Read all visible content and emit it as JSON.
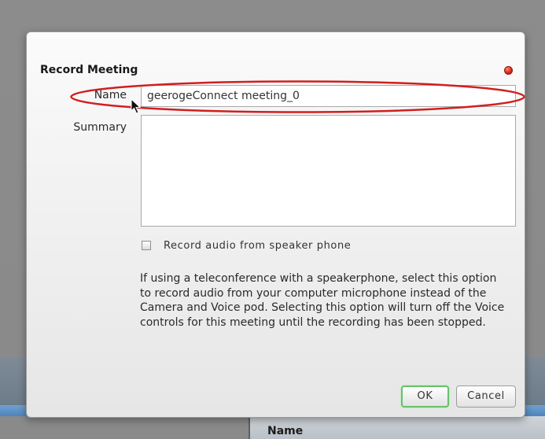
{
  "background": {
    "panel_header": "Name"
  },
  "dialog": {
    "title": "Record Meeting",
    "name_label": "Name",
    "name_value": "geerogeConnect meeting_0",
    "summary_label": "Summary",
    "summary_value": "",
    "checkbox_label": "Record audio from speaker phone",
    "checkbox_checked": false,
    "info_text": "If using a teleconference with a speakerphone, select this option to record audio from your computer microphone instead of the Camera and Voice pod. Selecting this option will turn off the Voice controls for this meeting until the recording has been stopped.",
    "ok_label": "OK",
    "cancel_label": "Cancel"
  },
  "colors": {
    "highlight": "#d11f1f",
    "close": "#e0281c",
    "ok_focus": "#69c16b"
  },
  "icons": {
    "close": "close-icon",
    "cursor": "mouse-pointer-icon"
  }
}
